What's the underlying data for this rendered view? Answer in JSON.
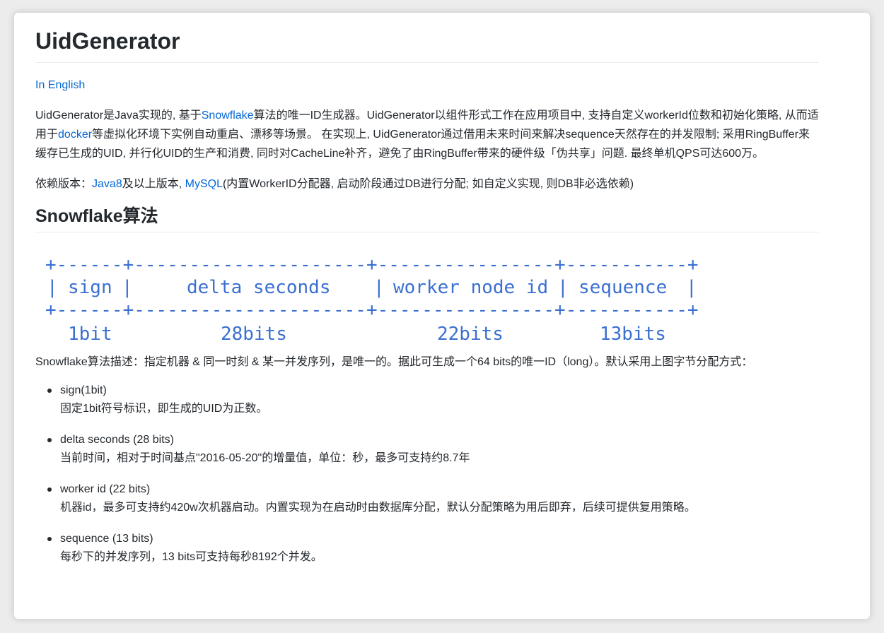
{
  "title": "UidGenerator",
  "lang_link": "In English",
  "intro": {
    "t1": "UidGenerator是Java实现的, 基于",
    "link1": "Snowflake",
    "t2": "算法的唯一ID生成器。UidGenerator以组件形式工作在应用项目中, 支持自定义workerId位数和初始化策略, 从而适用于",
    "link2": "docker",
    "t3": "等虚拟化环境下实例自动重启、漂移等场景。 在实现上, UidGenerator通过借用未来时间来解决sequence天然存在的并发限制; 采用RingBuffer来缓存已生成的UID, 并行化UID的生产和消费, 同时对CacheLine补齐，避免了由RingBuffer带来的硬件级「伪共享」问题. 最终单机QPS可达600万。"
  },
  "deps": {
    "t1": "依赖版本：",
    "link1": "Java8",
    "t2": "及以上版本, ",
    "link2": "MySQL",
    "t3": "(内置WorkerID分配器, 启动阶段通过DB进行分配; 如自定义实现, 则DB非必选依赖)"
  },
  "algo_title": "Snowflake算法",
  "diagram": {
    "fields": [
      "sign",
      "delta seconds",
      "worker node id",
      "sequence"
    ],
    "bits": [
      "1bit",
      "28bits",
      "22bits",
      "13bits"
    ],
    "color": "#3b6fd0"
  },
  "desc": "Snowflake算法描述：指定机器 & 同一时刻 & 某一并发序列，是唯一的。据此可生成一个64 bits的唯一ID（long）。默认采用上图字节分配方式：",
  "items": [
    {
      "title": "sign(1bit)",
      "desc": "固定1bit符号标识，即生成的UID为正数。"
    },
    {
      "title": "delta seconds (28 bits)",
      "desc": "当前时间，相对于时间基点\"2016-05-20\"的增量值，单位：秒，最多可支持约8.7年"
    },
    {
      "title": "worker id (22 bits)",
      "desc": "机器id，最多可支持约420w次机器启动。内置实现为在启动时由数据库分配，默认分配策略为用后即弃，后续可提供复用策略。"
    },
    {
      "title": "sequence (13 bits)",
      "desc": "每秒下的并发序列，13 bits可支持每秒8192个并发。"
    }
  ]
}
